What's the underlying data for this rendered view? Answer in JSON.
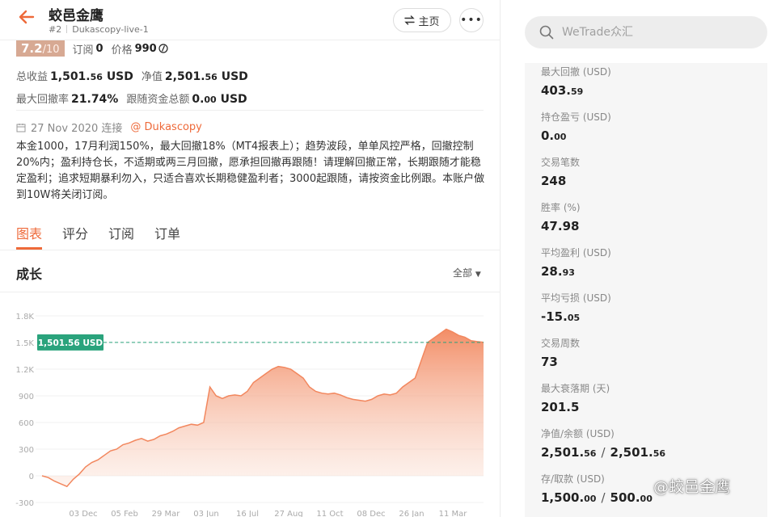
{
  "header": {
    "title": "蛟邑金鹰",
    "rank": "#2",
    "account": "Dukascopy-live-1",
    "home_label": "主页",
    "more_label": "•••"
  },
  "summary": {
    "score": "7.2",
    "score_max": "/10",
    "subscribe_label": "订阅",
    "subscribe_value": "0",
    "price_label": "价格",
    "price_value": "990",
    "total_profit_label": "总收益",
    "total_profit_main": "1,501.",
    "total_profit_dec": "56",
    "total_profit_unit": "USD",
    "equity_label": "净值",
    "equity_main": "2,501.",
    "equity_dec": "56",
    "equity_unit": "USD",
    "max_drawdown_label": "最大回撤率",
    "max_drawdown_value": "21.74%",
    "follow_total_label": "跟随资金总额",
    "follow_total_main": "0.",
    "follow_total_dec": "00",
    "follow_total_unit": "USD"
  },
  "info": {
    "date_text": "27 Nov 2020 连接",
    "broker_link": "@ Dukascopy",
    "description": "本金1000，17月利润150%，最大回撤18%（MT4报表上）；趋势波段，单单风控严格，回撤控制20%内；盈利持仓长，不适期或两三月回撤，愿承担回撤再跟随！请理解回撤正常，长期跟随才能稳定盈利；追求短期暴利勿入，只适合喜欢长期稳健盈利者；3000起跟随，请按资金比例跟。本账户做到10W将关闭订阅。"
  },
  "tabs": [
    {
      "label": "图表"
    },
    {
      "label": "评分"
    },
    {
      "label": "订阅"
    },
    {
      "label": "订单"
    }
  ],
  "section": {
    "title": "成长",
    "range_label": "全部"
  },
  "chart_data": {
    "type": "area",
    "title": "",
    "xlabel": "",
    "ylabel": "",
    "ylim": [
      -300,
      1800
    ],
    "yticks": [
      -300,
      0,
      300,
      600,
      900,
      "1.2K",
      "1.5K",
      "1.8K"
    ],
    "ytick_values": [
      -300,
      0,
      300,
      600,
      900,
      1200,
      1500,
      1800
    ],
    "xticks": [
      "03 Dec",
      "05 Feb",
      "29 Mar",
      "03 Jun",
      "16 Jul",
      "27 Aug",
      "11 Oct",
      "08 Dec",
      "26 Jan",
      "11 Mar"
    ],
    "current_label": "1,501.56 USD",
    "current_value": 1501.56,
    "values": [
      0,
      -20,
      -60,
      -90,
      -120,
      -40,
      20,
      100,
      150,
      180,
      230,
      280,
      300,
      350,
      370,
      400,
      420,
      390,
      410,
      450,
      470,
      500,
      540,
      560,
      580,
      570,
      600,
      1000,
      900,
      870,
      900,
      910,
      900,
      950,
      1050,
      1100,
      1150,
      1200,
      1230,
      1220,
      1200,
      1150,
      1100,
      1000,
      950,
      930,
      920,
      930,
      910,
      880,
      860,
      850,
      840,
      860,
      900,
      920,
      910,
      930,
      1000,
      1050,
      1100,
      1300,
      1500,
      1550,
      1600,
      1650,
      1620,
      1580,
      1560,
      1520,
      1510,
      1501.56
    ],
    "color": "#f2875e"
  },
  "search": {
    "placeholder": "WeTrade众汇"
  },
  "stats": [
    {
      "label": "最大回撤 (USD)",
      "main": "403.",
      "dec": "59"
    },
    {
      "label": "持仓盈亏 (USD)",
      "main": "0.",
      "dec": "00"
    },
    {
      "label": "交易笔数",
      "main": "248",
      "dec": ""
    },
    {
      "label": "胜率 (%)",
      "main": "47.98",
      "dec": ""
    },
    {
      "label": "平均盈利 (USD)",
      "main": "28.",
      "dec": "93"
    },
    {
      "label": "平均亏损 (USD)",
      "main": "-15.",
      "dec": "05"
    },
    {
      "label": "交易周数",
      "main": "73",
      "dec": ""
    },
    {
      "label": "最大衰落期 (天)",
      "main": "201.5",
      "dec": ""
    },
    {
      "label": "净值/余额 (USD)",
      "main": "2,501.",
      "dec": "56",
      "main2": "2,501.",
      "dec2": "56"
    },
    {
      "label": "存/取款 (USD)",
      "main": "1,500.",
      "dec": "00",
      "main2": "500.",
      "dec2": "00"
    }
  ],
  "watermark": "@蛟邑金鹰",
  "colors": {
    "accent": "#ee6a3a",
    "score_bg": "#d7a993",
    "marker": "#2aa37c"
  }
}
